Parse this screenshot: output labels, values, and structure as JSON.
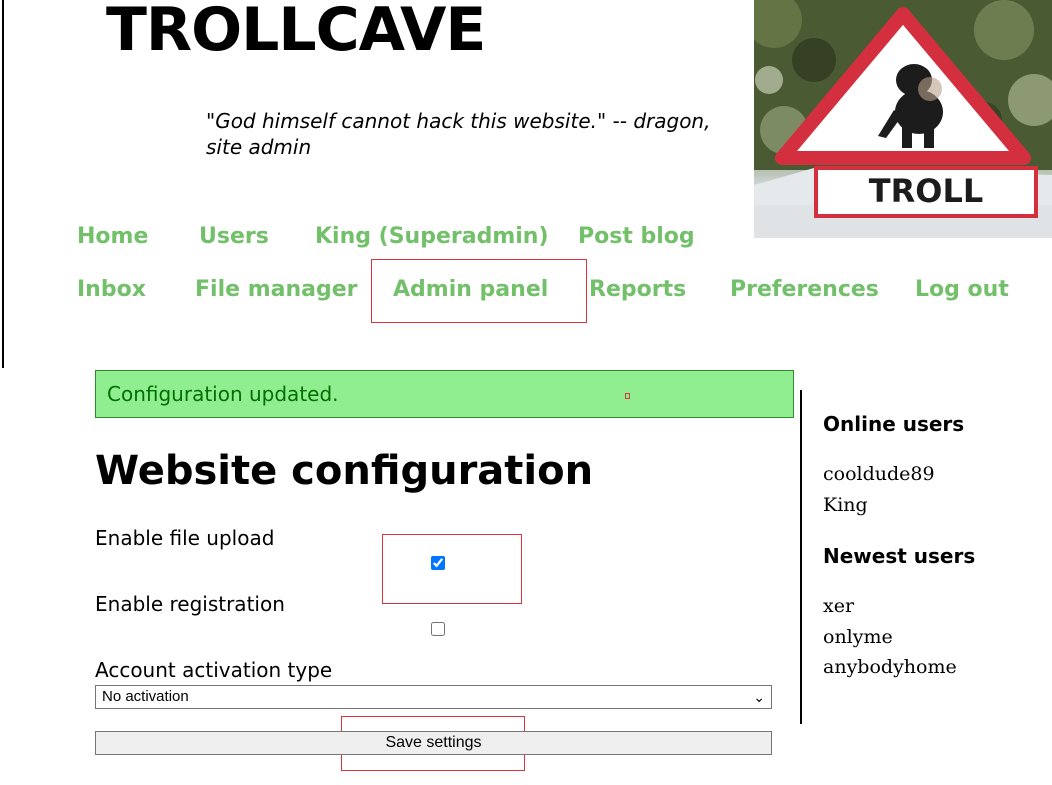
{
  "site": {
    "title": "TROLLCAVE",
    "quote": "\"God himself cannot hack this website.\" -- dragon, site admin"
  },
  "nav": {
    "row1": [
      "Home",
      "Users",
      "King (Superadmin)",
      "Post blog"
    ],
    "row2": [
      "Inbox",
      "File manager",
      "Admin panel",
      "Reports",
      "Preferences",
      "Log out"
    ],
    "link_color": "#73c06a"
  },
  "sign": {
    "text": "TROLL"
  },
  "alert": {
    "message": "Configuration updated."
  },
  "config": {
    "title": "Website configuration",
    "file_upload_label": "Enable file upload",
    "file_upload_checked": true,
    "registration_label": "Enable registration",
    "registration_checked": false,
    "activation_label": "Account activation type",
    "activation_value": "No activation",
    "save_label": "Save settings"
  },
  "sidebar": {
    "online_heading": "Online users",
    "online_users": [
      "cooldude89",
      "King"
    ],
    "newest_heading": "Newest users",
    "newest_users": [
      "xer",
      "onlyme",
      "anybodyhome"
    ]
  },
  "colors": {
    "alert_bg": "#90ee90",
    "alert_text": "#007000",
    "highlight": "#d8343b"
  }
}
